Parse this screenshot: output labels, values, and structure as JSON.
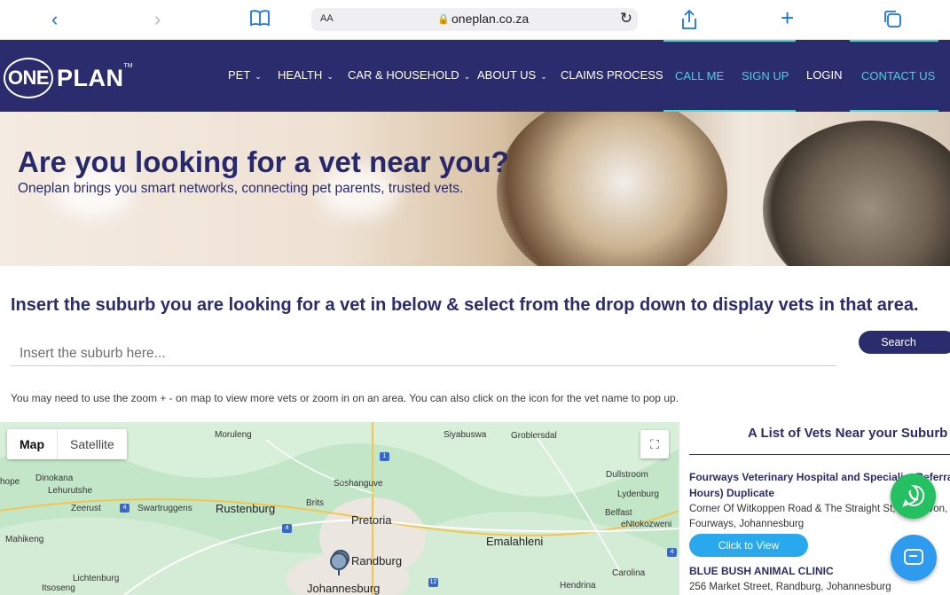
{
  "browser": {
    "reader_label": "AA",
    "url": "oneplan.co.za",
    "icons": [
      "back-icon",
      "forward-icon",
      "bookmarks-icon",
      "share-icon",
      "new-tab-icon",
      "tabs-icon",
      "lock-icon",
      "reload-icon"
    ]
  },
  "header": {
    "logo_one": "ONE",
    "logo_plan": "PLAN",
    "logo_tm": "TM",
    "nav": [
      {
        "label": "PET",
        "has_dropdown": true
      },
      {
        "label": "HEALTH",
        "has_dropdown": true
      },
      {
        "label": "CAR & HOUSEHOLD",
        "has_dropdown": true
      },
      {
        "label": "ABOUT US",
        "has_dropdown": true
      },
      {
        "label": "CLAIMS PROCESS",
        "has_dropdown": false
      }
    ],
    "call_me": "CALL ME",
    "sign_up": "SIGN UP",
    "login": "LOGIN",
    "contact_us": "CONTACT US",
    "accent_color": "#4fd1d9",
    "brand_color": "#2b2c6e"
  },
  "hero": {
    "title": "Are you looking for a vet near you?",
    "subtitle": "Oneplan brings you smart networks, connecting pet parents, trusted vets."
  },
  "search": {
    "instruction": "Insert the suburb you are looking for a vet in below & select from the drop down to display vets in that area.",
    "placeholder": "Insert the suburb here...",
    "button": "Search",
    "note": "You may need to use the zoom + - on map to view more vets or zoom in on an area. You can also click on the icon for the vet name to pop up."
  },
  "map": {
    "tab_map": "Map",
    "tab_satellite": "Satellite",
    "places": [
      "Moruleng",
      "Siyabuswa",
      "Groblersdal",
      "Dinokana",
      "Lehurutshe",
      "Zeerust",
      "Swartruggens",
      "Rustenburg",
      "Brits",
      "Soshanguve",
      "Pretoria",
      "Dullstroom",
      "Lydenburg",
      "Belfast",
      "eNtokozweni",
      "Emalahleni",
      "Mahikeng",
      "Lichtenburg",
      "Itsoseng",
      "Randburg",
      "Johannesburg",
      "Hendrina",
      "Carolina",
      "hope"
    ]
  },
  "vets": {
    "heading": "A List of Vets Near your Suburb",
    "items": [
      {
        "name_line1": "Fourways Veterinary Hospital and Specialist Referral",
        "name_line2": "Hours) Duplicate",
        "address_line1": "Corner Of Witkoppen Road & The Straight St, Craigavon,",
        "address_line2": "Fourways, Johannesburg",
        "button": "Click to View"
      },
      {
        "name_line1": "BLUE BUSH ANIMAL CLINIC",
        "address_line1": "256 Market Street, Randburg, Johannesburg"
      }
    ]
  },
  "fab": {
    "whatsapp_icon": "whatsapp-icon",
    "chat_icon": "chat-icon"
  }
}
